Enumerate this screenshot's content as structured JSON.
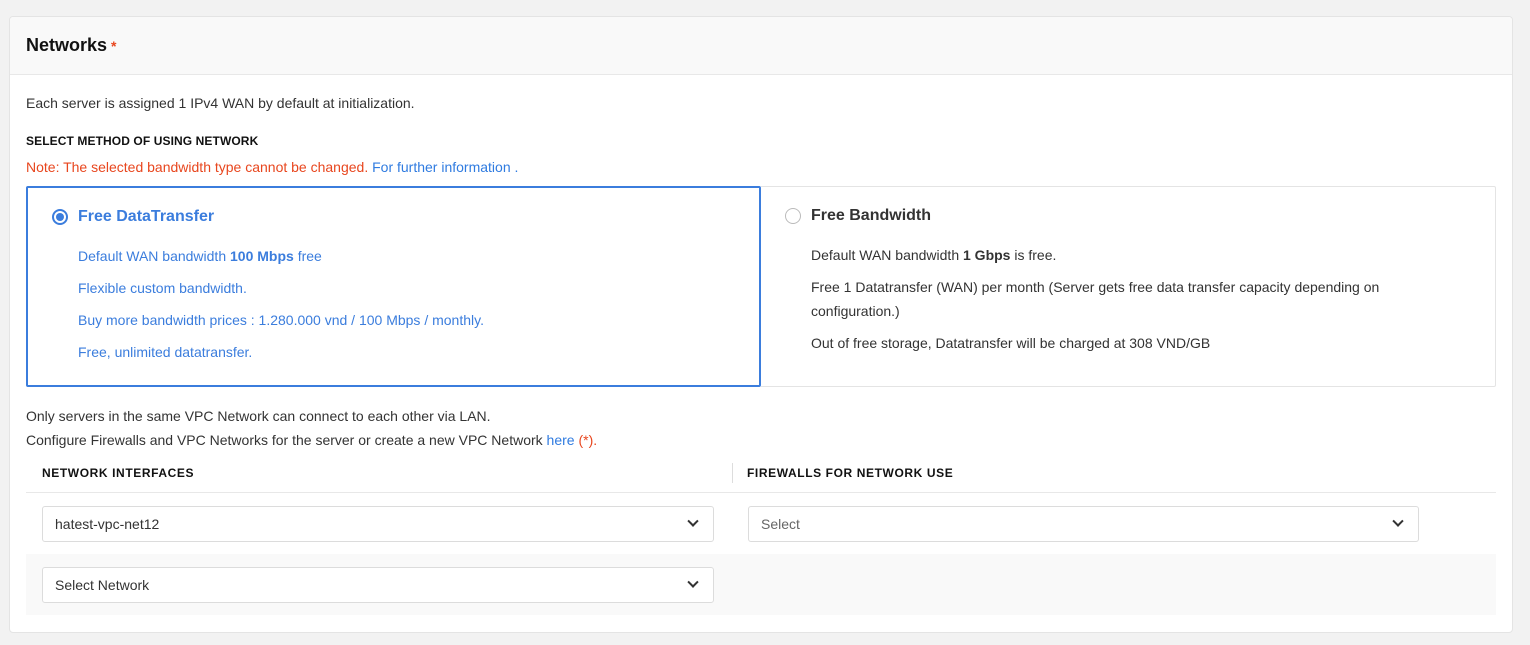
{
  "header": {
    "title": "Networks",
    "required_mark": "*"
  },
  "intro": "Each server is assigned 1 IPv4 WAN by default at initialization.",
  "method_label": "SELECT METHOD OF USING NETWORK",
  "note": {
    "text": "Note: The selected bandwidth type cannot be changed.",
    "link": "For further information",
    "suffix": "."
  },
  "options": [
    {
      "title": "Free DataTransfer",
      "selected": true,
      "lines": {
        "l1_pre": "Default WAN bandwidth ",
        "l1_bold": "100 Mbps",
        "l1_post": " free",
        "l2": "Flexible custom bandwidth.",
        "l3": "Buy more bandwidth prices : 1.280.000 vnd / 100 Mbps / monthly.",
        "l4": "Free, unlimited datatransfer."
      }
    },
    {
      "title": "Free Bandwidth",
      "selected": false,
      "lines": {
        "l1_pre": "Default WAN bandwidth ",
        "l1_bold": "1 Gbps",
        "l1_post": " is free.",
        "l2": "Free 1 Datatransfer (WAN) per month (Server gets free data transfer capacity depending on configuration.)",
        "l3": "Out of free storage, Datatransfer will be charged at 308 VND/GB"
      }
    }
  ],
  "lan": {
    "line1": "Only servers in the same VPC Network can connect to each other via LAN.",
    "line2_pre": "Configure Firewalls and VPC Networks for the server or create a new VPC Network ",
    "line2_link": "here",
    "line2_ast": "(*)",
    "line2_suffix": "."
  },
  "table": {
    "col1": "NETWORK INTERFACES",
    "col2": "FIREWALLS FOR NETWORK USE",
    "row1": {
      "network": "hatest-vpc-net12",
      "firewall_placeholder": "Select"
    },
    "row2": {
      "network_placeholder": "Select Network"
    }
  },
  "colors": {
    "accent": "#3b7ddd",
    "warning": "#e8461e",
    "link": "#2f7be0"
  }
}
